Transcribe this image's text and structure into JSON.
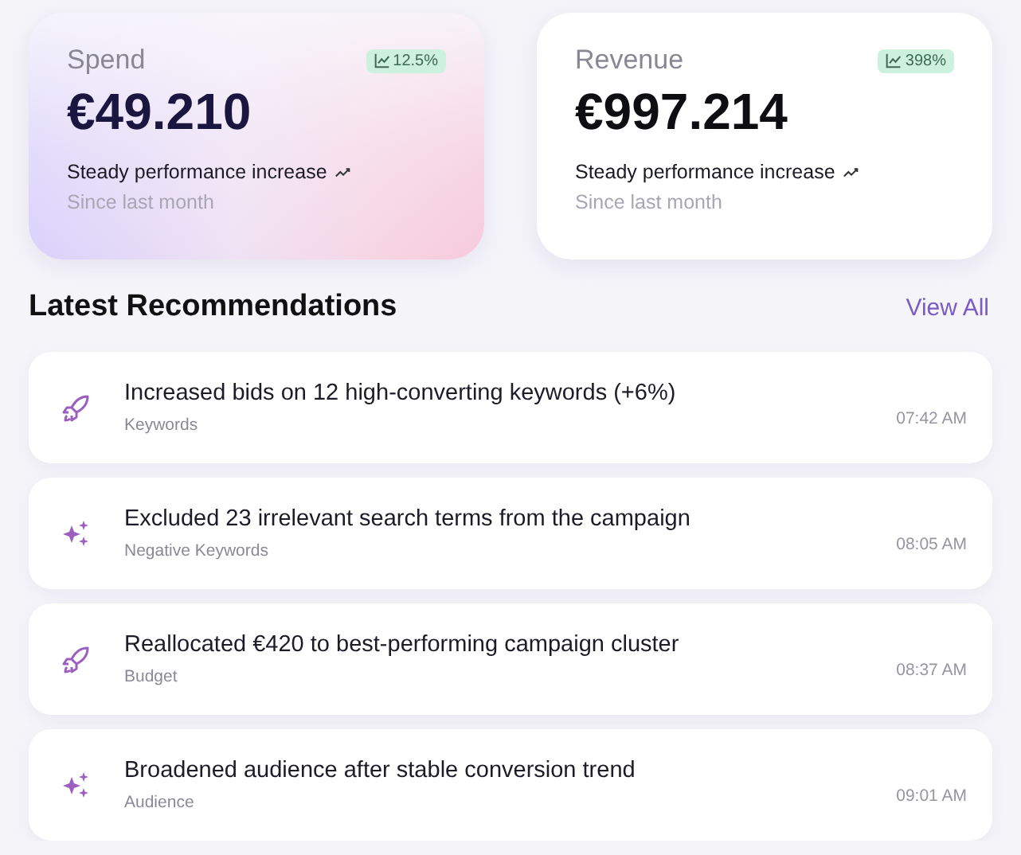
{
  "stats": [
    {
      "label": "Spend",
      "badge": "12.5%",
      "value": "€49.210",
      "trend": "Steady performance increase",
      "period": "Since last month",
      "kind": "gradient"
    },
    {
      "label": "Revenue",
      "badge": "398%",
      "value": "€997.214",
      "trend": "Steady performance increase",
      "period": "Since last month",
      "kind": "plain"
    }
  ],
  "recommendations": {
    "title": "Latest Recommendations",
    "link": "View All",
    "items": [
      {
        "kind": "rocket",
        "text": "Increased bids on 12 high-converting keywords (+6%)",
        "category": "Keywords",
        "time": "07:42 AM"
      },
      {
        "kind": "sparkles",
        "text": "Excluded 23 irrelevant search terms from the campaign",
        "category": "Negative Keywords",
        "time": "08:05 AM"
      },
      {
        "kind": "rocket",
        "text": "Reallocated €420 to best-performing campaign cluster",
        "category": "Budget",
        "time": "08:37 AM"
      },
      {
        "kind": "sparkles",
        "text": "Broadened audience after stable conversion trend",
        "category": "Audience",
        "time": "09:01 AM"
      }
    ]
  }
}
